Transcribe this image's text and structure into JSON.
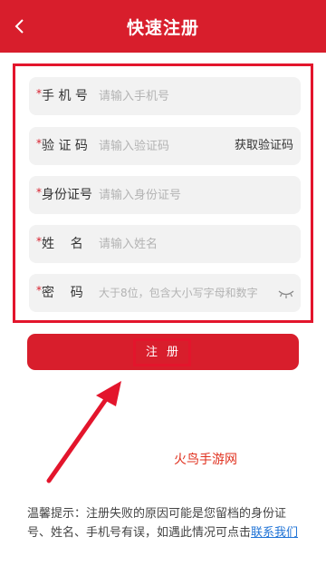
{
  "header": {
    "title": "快速注册"
  },
  "form": {
    "rows": [
      {
        "label": "手 机 号",
        "placeholder": "请输入手机号"
      },
      {
        "label": "验 证 码",
        "placeholder": "请输入验证码",
        "action": "获取验证码"
      },
      {
        "label": "身份证号",
        "placeholder": "请输入身份证号"
      },
      {
        "label": "姓    名",
        "placeholder": "请输入姓名"
      },
      {
        "label": "密    码",
        "placeholder": "大于8位，包含大小写字母和数字"
      }
    ],
    "required_mark": "*"
  },
  "register_button": {
    "label": "注册"
  },
  "watermark": "火鸟手游网",
  "tip": {
    "text": "温馨提示：注册失败的原因可能是您留档的身份证号、姓名、手机号有误，如遇此情况可点击",
    "link": "联系我们"
  },
  "colors": {
    "brand": "#d81e2c",
    "highlight_border": "#e3152c",
    "link": "#1f73d6"
  }
}
